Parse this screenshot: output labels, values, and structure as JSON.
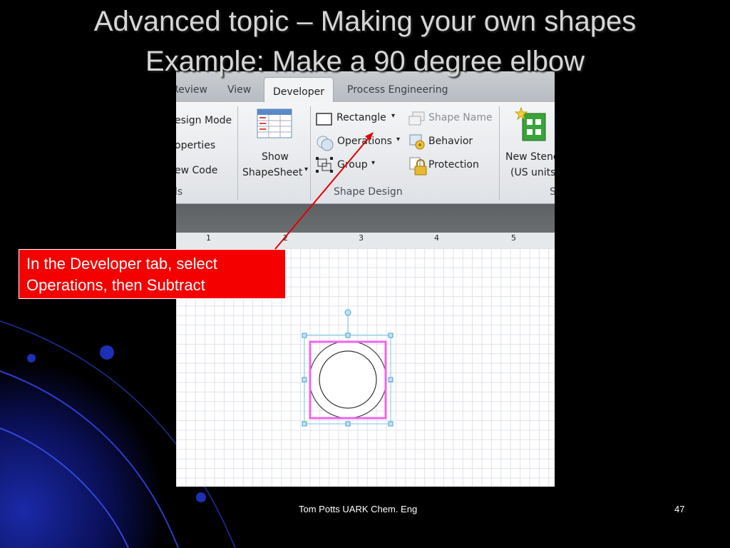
{
  "slide": {
    "title_line1": "Advanced topic – Making your own shapes",
    "title_line2": "Example: Make a 90 degree elbow",
    "callout": "In the Developer tab, select Operations, then Subtract",
    "footer_author": "Tom Potts  UARK Chem. Eng",
    "page_number": "47"
  },
  "ribbon": {
    "tabs": [
      "Review",
      "View",
      "Developer",
      "Process Engineering"
    ],
    "active_tab": "Developer",
    "code_group": {
      "items": [
        "esign Mode",
        "operties",
        "ew Code"
      ],
      "label": "ls"
    },
    "show_shapesheet": [
      "Show",
      "ShapeSheet"
    ],
    "shape_design": {
      "rectangle": "Rectangle",
      "operations": "Operations",
      "group": "Group",
      "shape_name": "Shape Name",
      "behavior": "Behavior",
      "protection": "Protection",
      "label": "Shape Design"
    },
    "new_stencil": [
      "New Stenc",
      "(US units"
    ],
    "last_group_label": "S"
  },
  "ruler": [
    "1",
    "2",
    "3",
    "4",
    "5"
  ],
  "colors": {
    "callout_bg": "#f50000",
    "arrow": "#e00000",
    "selection_rect": "#ee66ee",
    "handles": "#7ac4ee"
  }
}
